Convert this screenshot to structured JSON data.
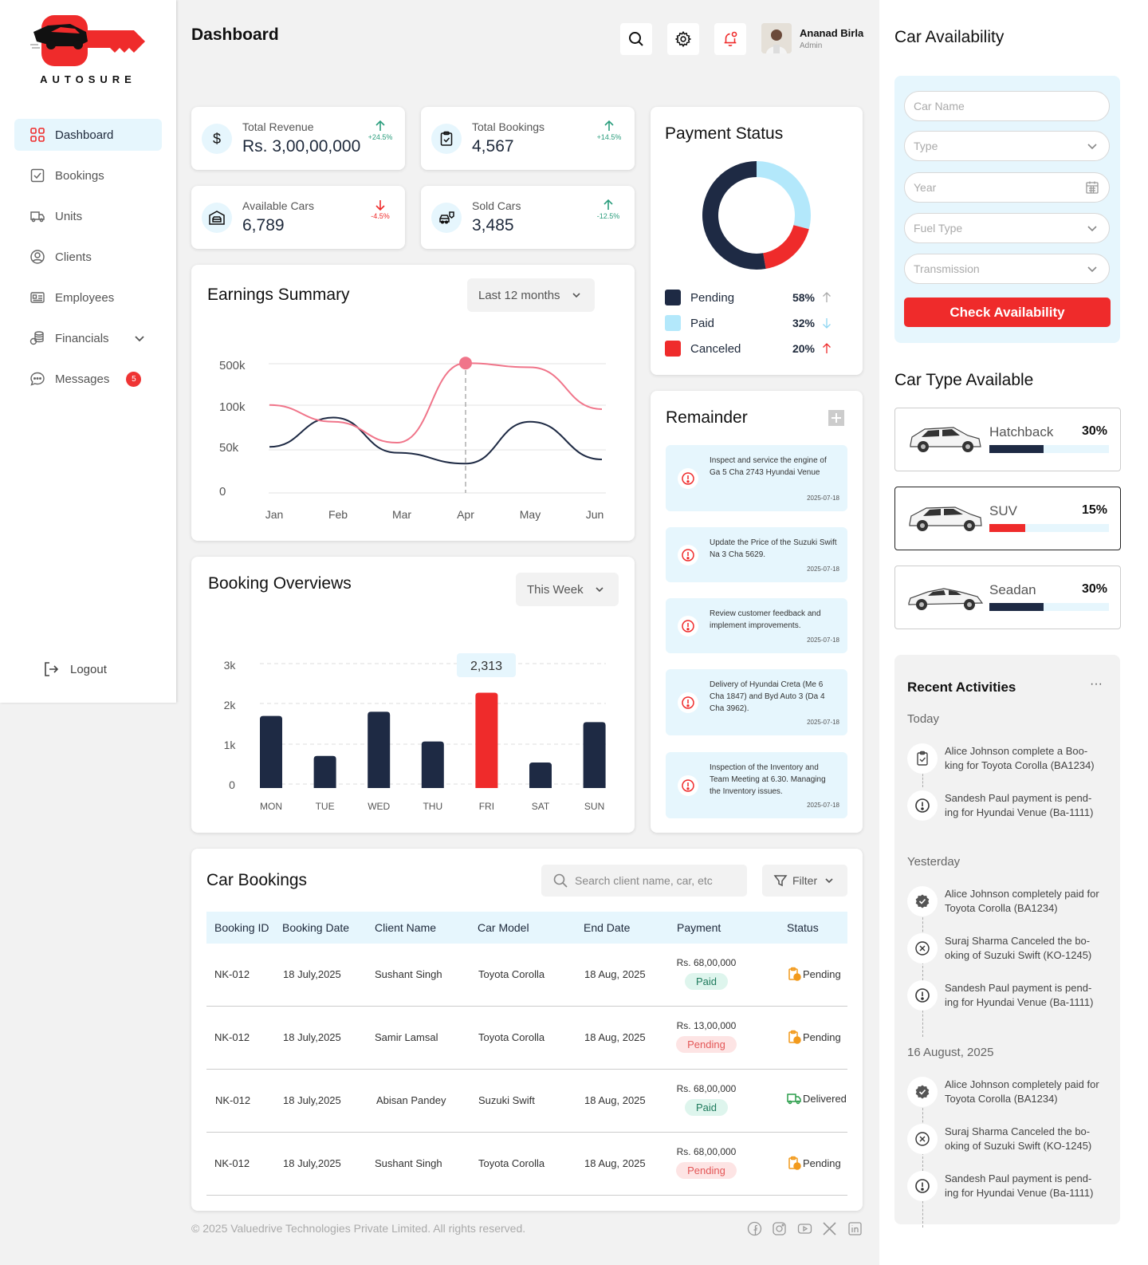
{
  "brand": {
    "name": "AUTOSURE",
    "primary": "#ef2b2b",
    "navy": "#1e2a44",
    "light_blue": "#e6f6fd"
  },
  "sidebar": {
    "items": [
      {
        "label": "Dashboard",
        "icon": "grid-icon"
      },
      {
        "label": "Bookings",
        "icon": "check-doc-icon"
      },
      {
        "label": "Units",
        "icon": "truck-icon"
      },
      {
        "label": "Clients",
        "icon": "user-circle-icon"
      },
      {
        "label": "Employees",
        "icon": "id-card-icon"
      },
      {
        "label": "Financials",
        "icon": "coins-icon"
      },
      {
        "label": "Messages",
        "icon": "chat-icon",
        "badge": "5"
      }
    ],
    "logout": "Logout"
  },
  "header": {
    "title": "Dashboard",
    "user_name": "Ananad Birla",
    "user_role": "Admin"
  },
  "stats": [
    {
      "label": "Total Revenue",
      "value": "Rs. 3,00,00,000",
      "trend": "+24.5%",
      "direction": "up"
    },
    {
      "label": "Total Bookings",
      "value": "4,567",
      "trend": "+14.5%",
      "direction": "up"
    },
    {
      "label": "Available Cars",
      "value": "6,789",
      "trend": "-4.5%",
      "direction": "down"
    },
    {
      "label": "Sold Cars",
      "value": "3,485",
      "trend": "-12.5%",
      "direction": "up"
    }
  ],
  "earnings": {
    "title": "Earnings Summary",
    "range": "Last 12 months",
    "y_ticks": [
      "500k",
      "100k",
      "50k",
      "0"
    ],
    "x_ticks": [
      "Jan",
      "Feb",
      "Mar",
      "Apr",
      "May",
      "Jun"
    ]
  },
  "bookings_overview": {
    "title": "Booking Overviews",
    "range": "This Week",
    "highlight": "2,313",
    "y_ticks": [
      "3k",
      "2k",
      "1k",
      "0"
    ]
  },
  "payment": {
    "title": "Payment Status",
    "items": [
      {
        "label": "Pending",
        "pct": "58%",
        "color": "#1e2a44"
      },
      {
        "label": "Paid",
        "pct": "32%",
        "color": "#b3e8fb"
      },
      {
        "label": "Canceled",
        "pct": "20%",
        "color": "#ef2b2b"
      }
    ]
  },
  "chart_data": [
    {
      "type": "line",
      "x": [
        "Jan",
        "Feb",
        "Mar",
        "Apr",
        "May",
        "Jun"
      ],
      "y_tick_labels": [
        "0",
        "50k",
        "100k",
        "500k"
      ],
      "series": [
        {
          "values": [
            105,
            85,
            60,
            155,
            150,
            100
          ],
          "color": "#f0758a"
        },
        {
          "values": [
            55,
            90,
            48,
            35,
            85,
            40
          ],
          "color": "#1e2a44"
        }
      ],
      "highlight": {
        "x": "Apr",
        "value": 155
      },
      "grid": true
    },
    {
      "type": "bar",
      "categories": [
        "MON",
        "TUE",
        "WED",
        "THU",
        "FRI",
        "SAT",
        "SUN"
      ],
      "values": [
        1750,
        780,
        1850,
        1130,
        2313,
        620,
        1600
      ],
      "ylim": [
        0,
        3000
      ],
      "highlight": "FRI",
      "colors": {
        "default": "#1e2a44",
        "highlight": "#ef2b2b"
      }
    },
    {
      "type": "pie",
      "labels": [
        "Pending",
        "Paid",
        "Canceled"
      ],
      "values": [
        58,
        32,
        20
      ],
      "colors": [
        "#1e2a44",
        "#b3e8fb",
        "#ef2b2b"
      ]
    }
  ],
  "reminder": {
    "title": "Remainder",
    "items": [
      {
        "text": "Inspect and service the engine of Ga 5 Cha 2743 Hyundai Venue",
        "date": "2025-07-18"
      },
      {
        "text": "Update the Price of the Suzuki Swift Na 3 Cha 5629.",
        "date": "2025-07-18"
      },
      {
        "text": "Review customer feedback and implement improvements.",
        "date": "2025-07-18"
      },
      {
        "text": "Delivery of Hyundai Creta (Me 6 Cha 1847) and Byd Auto 3 (Da 4 Cha 3962).",
        "date": "2025-07-18"
      },
      {
        "text": "Inspection of the Inventory and Team Meeting at 6.30. Managing the Inventory issues.",
        "date": "2025-07-18"
      }
    ]
  },
  "bookings": {
    "title": "Car Bookings",
    "search_placeholder": "Search client name, car, etc",
    "filter": "Filter",
    "columns": [
      "Booking ID",
      "Booking Date",
      "Client Name",
      "Car Model",
      "End Date",
      "Payment",
      "Status"
    ],
    "rows": [
      {
        "id": "NK-012",
        "date": "18 July,2025",
        "client": "Sushant Singh",
        "car": "Toyota Corolla",
        "end": "18 Aug, 2025",
        "amount": "Rs. 68,00,000",
        "payment": "Paid",
        "status": "Pending"
      },
      {
        "id": "NK-012",
        "date": "18 July,2025",
        "client": "Samir Lamsal",
        "car": "Toyota Corolla",
        "end": "18 Aug, 2025",
        "amount": "Rs. 13,00,000",
        "payment": "Pending",
        "status": "Pending"
      },
      {
        "id": "NK-012",
        "date": "18 July,2025",
        "client": "Abisan Pandey",
        "car": "Suzuki Swift",
        "end": "18 Aug, 2025",
        "amount": "Rs. 68,00,000",
        "payment": "Paid",
        "status": "Delivered"
      },
      {
        "id": "NK-012",
        "date": "18 July,2025",
        "client": "Sushant Singh",
        "car": "Toyota Corolla",
        "end": "18 Aug, 2025",
        "amount": "Rs. 68,00,000",
        "payment": "Pending",
        "status": "Pending"
      }
    ]
  },
  "footer": {
    "copyright": "© 2025 Valuedrive Technologies Private Limited. All rights reserved."
  },
  "availability": {
    "title": "Car Availability",
    "fields": {
      "car_name": "Car Name",
      "type": "Type",
      "year": "Year",
      "fuel": "Fuel Type",
      "transmission": "Transmission"
    },
    "button": "Check Availability"
  },
  "car_types": {
    "title": "Car Type Available",
    "items": [
      {
        "name": "Hatchback",
        "pct": "30%",
        "value": 0.45,
        "color": "#1e2a44"
      },
      {
        "name": "SUV",
        "pct": "15%",
        "value": 0.3,
        "color": "#ef2b2b"
      },
      {
        "name": "Seadan",
        "pct": "30%",
        "value": 0.45,
        "color": "#1e2a44"
      }
    ]
  },
  "recent": {
    "title": "Recent Activities",
    "groups": [
      {
        "label": "Today",
        "items": [
          {
            "text": "Alice Johnson complete a Boo-king for Toyota Corolla (BA1234)",
            "icon": "clipboard-check-icon"
          },
          {
            "text": "Sandesh Paul payment is pend-ing for Hyundai Venue (Ba-1111)",
            "icon": "alert-icon"
          }
        ]
      },
      {
        "label": "Yesterday",
        "items": [
          {
            "text": "Alice Johnson completely paid for Toyota Corolla (BA1234)",
            "icon": "verified-icon"
          },
          {
            "text": "Suraj Sharma Canceled the bo-oking of Suzuki Swift (KO-1245)",
            "icon": "cancel-icon"
          },
          {
            "text": "Sandesh Paul payment is pend-ing for Hyundai Venue (Ba-1111)",
            "icon": "alert-icon"
          }
        ]
      },
      {
        "label": "16 August, 2025",
        "items": [
          {
            "text": "Alice Johnson completely paid for Toyota Corolla (BA1234)",
            "icon": "verified-icon"
          },
          {
            "text": "Suraj Sharma Canceled the bo-oking of Suzuki Swift (KO-1245)",
            "icon": "cancel-icon"
          },
          {
            "text": "Sandesh Paul payment is pend-ing for Hyundai Venue (Ba-1111)",
            "icon": "alert-icon"
          }
        ]
      }
    ]
  }
}
